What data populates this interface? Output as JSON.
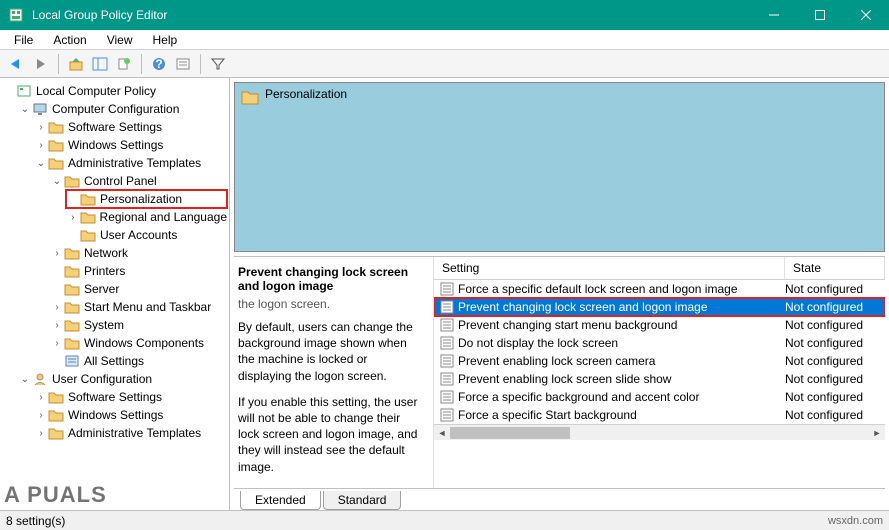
{
  "window": {
    "title": "Local Group Policy Editor"
  },
  "menubar": {
    "file": "File",
    "action": "Action",
    "view": "View",
    "help": "Help"
  },
  "tree": {
    "root": "Local Computer Policy",
    "computer_config": "Computer Configuration",
    "software_settings": "Software Settings",
    "windows_settings": "Windows Settings",
    "admin_templates": "Administrative Templates",
    "control_panel": "Control Panel",
    "personalization": "Personalization",
    "regional": "Regional and Language",
    "user_accounts": "User Accounts",
    "network": "Network",
    "printers": "Printers",
    "server": "Server",
    "start_menu": "Start Menu and Taskbar",
    "system": "System",
    "windows_components": "Windows Components",
    "all_settings": "All Settings",
    "user_config": "User Configuration",
    "u_software_settings": "Software Settings",
    "u_windows_settings": "Windows Settings",
    "u_admin_templates": "Administrative Templates"
  },
  "detail": {
    "header_title": "Personalization",
    "setting_title": "Prevent changing lock screen and logon image",
    "truncated_text": "the logon screen.",
    "para1": "By default, users can change the background image shown when the machine is locked or displaying the logon screen.",
    "para2": "If you enable this setting, the user will not be able to change their lock screen and logon image, and they will instead see the default image.",
    "col_setting": "Setting",
    "col_state": "State",
    "rows": [
      {
        "label": "Force a specific default lock screen and logon image",
        "state": "Not configured"
      },
      {
        "label": "Prevent changing lock screen and logon image",
        "state": "Not configured"
      },
      {
        "label": "Prevent changing start menu background",
        "state": "Not configured"
      },
      {
        "label": "Do not display the lock screen",
        "state": "Not configured"
      },
      {
        "label": "Prevent enabling lock screen camera",
        "state": "Not configured"
      },
      {
        "label": "Prevent enabling lock screen slide show",
        "state": "Not configured"
      },
      {
        "label": "Force a specific background and accent color",
        "state": "Not configured"
      },
      {
        "label": "Force a specific Start background",
        "state": "Not configured"
      }
    ]
  },
  "tabs": {
    "extended": "Extended",
    "standard": "Standard"
  },
  "status": {
    "count": "8 setting(s)",
    "watermark": "wsxdn.com"
  },
  "brand": "A  PUALS"
}
